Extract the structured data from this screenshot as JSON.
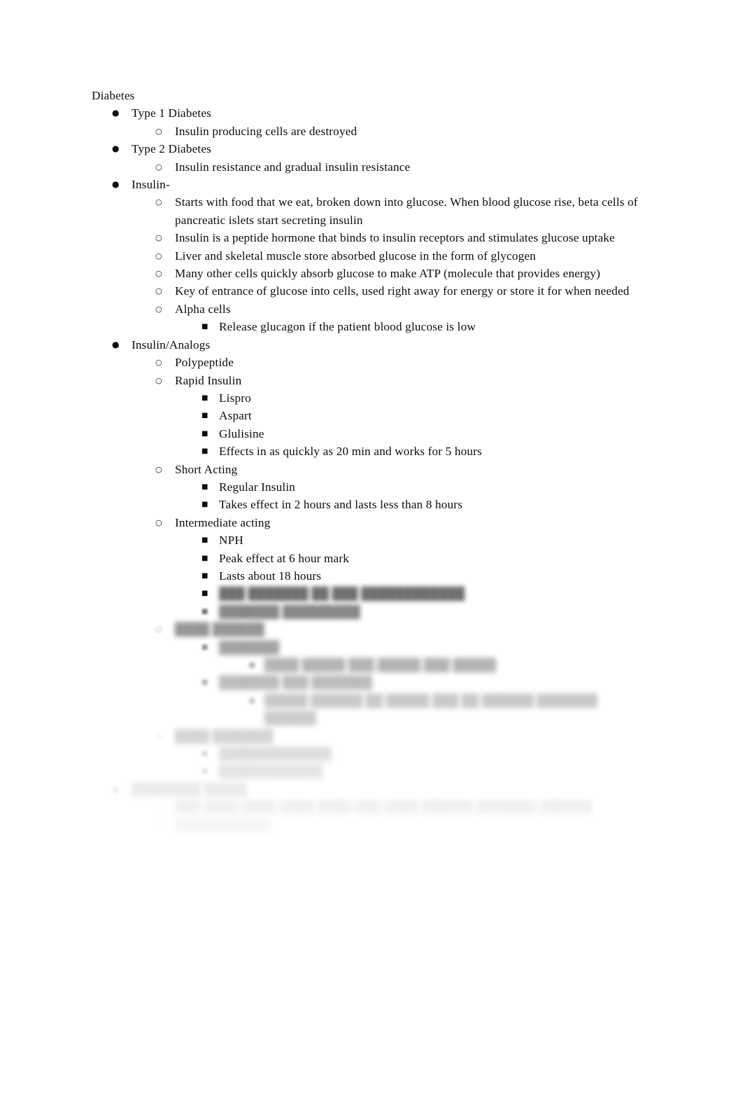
{
  "document": {
    "title": "Diabetes",
    "font_color": "#0d0d0d",
    "background_color": "#ffffff",
    "markers": {
      "level1": "●",
      "level2": "○",
      "level3": "■",
      "level4": "●"
    },
    "redaction": {
      "type": "blur-fade",
      "note": "Lines below 'Lasts about 18 hours' are blurred and faded to white; their text is not legible in the source image.",
      "starts_after_line": "Lasts about 18 hours"
    },
    "outline": [
      {
        "level": 0,
        "marker": "none",
        "text": "Diabetes",
        "legible": true
      },
      {
        "level": 1,
        "marker": "level1",
        "text": "Type 1 Diabetes",
        "legible": true
      },
      {
        "level": 2,
        "marker": "level2",
        "text": "Insulin producing cells are destroyed",
        "legible": true
      },
      {
        "level": 1,
        "marker": "level1",
        "text": "Type 2 Diabetes",
        "legible": true
      },
      {
        "level": 2,
        "marker": "level2",
        "text": "Insulin resistance and gradual insulin resistance",
        "legible": true
      },
      {
        "level": 1,
        "marker": "level1",
        "text": "Insulin-",
        "legible": true
      },
      {
        "level": 2,
        "marker": "level2",
        "text": "Starts with food that we eat, broken down into glucose. When blood glucose rise, beta cells of pancreatic islets start secreting insulin",
        "legible": true
      },
      {
        "level": 2,
        "marker": "level2",
        "text": "Insulin is a peptide hormone that binds to insulin receptors and stimulates glucose uptake",
        "legible": true
      },
      {
        "level": 2,
        "marker": "level2",
        "text": "Liver and skeletal muscle store absorbed glucose in the form of glycogen",
        "legible": true
      },
      {
        "level": 2,
        "marker": "level2",
        "text": "Many other cells quickly absorb glucose to make ATP (molecule that provides energy)",
        "legible": true
      },
      {
        "level": 2,
        "marker": "level2",
        "text": "Key of entrance of glucose into cells, used right away for energy or store it for when needed",
        "legible": true
      },
      {
        "level": 2,
        "marker": "level2",
        "text": "Alpha cells",
        "legible": true
      },
      {
        "level": 3,
        "marker": "level3",
        "text": "Release glucagon if the patient blood glucose is low",
        "legible": true
      },
      {
        "level": 1,
        "marker": "level1",
        "text": "Insulin/Analogs",
        "legible": true
      },
      {
        "level": 2,
        "marker": "level2",
        "text": "Polypeptide",
        "legible": true
      },
      {
        "level": 2,
        "marker": "level2",
        "text": "Rapid Insulin",
        "legible": true
      },
      {
        "level": 3,
        "marker": "level3",
        "text": "Lispro",
        "legible": true
      },
      {
        "level": 3,
        "marker": "level3",
        "text": "Aspart",
        "legible": true
      },
      {
        "level": 3,
        "marker": "level3",
        "text": "Glulisine",
        "legible": true
      },
      {
        "level": 3,
        "marker": "level3",
        "text": "Effects in as quickly as 20 min and works for 5 hours",
        "legible": true
      },
      {
        "level": 2,
        "marker": "level2",
        "text": "Short Acting",
        "legible": true
      },
      {
        "level": 3,
        "marker": "level3",
        "text": "Regular Insulin",
        "legible": true
      },
      {
        "level": 3,
        "marker": "level3",
        "text": "Takes effect in 2 hours and lasts less than 8 hours",
        "legible": true
      },
      {
        "level": 2,
        "marker": "level2",
        "text": "Intermediate acting",
        "legible": true
      },
      {
        "level": 3,
        "marker": "level3",
        "text": "NPH",
        "legible": true
      },
      {
        "level": 3,
        "marker": "level3",
        "text": "Peak effect at 6 hour mark",
        "legible": true
      },
      {
        "level": 3,
        "marker": "level3",
        "text": "Lasts about 18 hours",
        "legible": true
      },
      {
        "level": 3,
        "marker": "level3",
        "text": "███ ███████ ██ ███ ████████████",
        "legible": false
      },
      {
        "level": 3,
        "marker": "level3",
        "text": "███████ █████████",
        "legible": false
      },
      {
        "level": 2,
        "marker": "level2",
        "text": "████ ██████",
        "legible": false
      },
      {
        "level": 3,
        "marker": "level3",
        "text": "███████",
        "legible": false
      },
      {
        "level": 4,
        "marker": "level4",
        "text": "████ █████ ███ █████ ███ █████",
        "legible": false
      },
      {
        "level": 3,
        "marker": "level3",
        "text": "███████ ███ ███████",
        "legible": false
      },
      {
        "level": 4,
        "marker": "level4",
        "text": "█████ ██████ ██ █████ ███ ██ ██████ ███████ ██████",
        "legible": false
      },
      {
        "level": 2,
        "marker": "level2",
        "text": "████ ███████",
        "legible": false
      },
      {
        "level": 3,
        "marker": "level3",
        "text": "█████████████",
        "legible": false
      },
      {
        "level": 3,
        "marker": "level3",
        "text": "████████████",
        "legible": false
      },
      {
        "level": 1,
        "marker": "level1",
        "text": "████████ █████",
        "legible": false
      },
      {
        "level": 2,
        "marker": "level2",
        "text": "███ ████ ████ ████ ████ ███ ████ ██████ ███████ ██████",
        "legible": false
      },
      {
        "level": 2,
        "marker": "level2",
        "text": "███████████",
        "legible": false
      }
    ]
  }
}
